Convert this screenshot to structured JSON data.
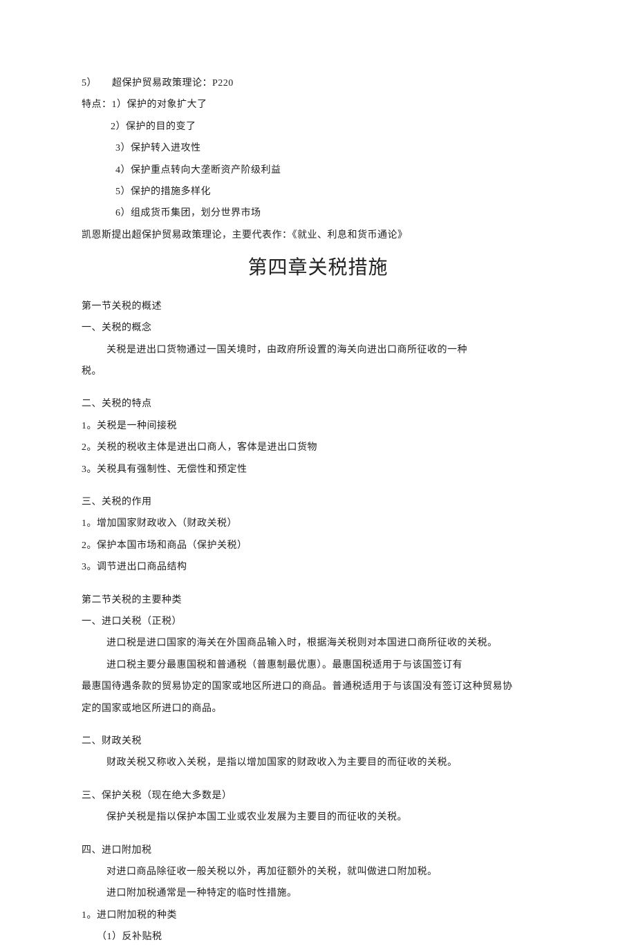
{
  "top": {
    "theory": "5）　　超保护贸易政策理论：P220",
    "featuresLabel": "特点：1）保护的对象扩大了",
    "feat2": "2）保护的目的变了",
    "feat3": "3）保护转入进攻性",
    "feat4": "4）保护重点转向大垄断资产阶级利益",
    "feat5": "5）保护的措施多样化",
    "feat6": "6）组成货币集团，划分世界市场",
    "keynes": "凯恩斯提出超保护贸易政策理论，主要代表作：《就业、利息和货币通论》"
  },
  "chapterTitle": "第四章关税措施",
  "sec1": {
    "title": "第一节关税的概述",
    "s1h": "一、关税的概念",
    "s1p1": "关税是进出口货物通过一国关境时，由政府所设置的海关向进出口商所征收的一种",
    "s1p2": "税。",
    "s2h": "二、关税的特点",
    "s2i1": "1。关税是一种间接税",
    "s2i2": "2。关税的税收主体是进出口商人，客体是进出口货物",
    "s2i3": "3。关税具有强制性、无偿性和预定性",
    "s3h": "三、关税的作用",
    "s3i1": "1。增加国家财政收入（财政关税）",
    "s3i2": "2。保护本国市场和商品（保护关税）",
    "s3i3": "3。调节进出口商品结构"
  },
  "sec2": {
    "title": "第二节关税的主要种类",
    "s1h": "一、进口关税（正税）",
    "s1p1": "进口税是进口国家的海关在外国商品输入时，根据海关税则对本国进口商所征收的关税。",
    "s1p2": "进口税主要分最惠国税和普通税（普惠制最优惠）。最惠国税适用于与该国签订有",
    "s1p3": "最惠国待遇条款的贸易协定的国家或地区所进口的商品。普通税适用于与该国没有签订这种贸易协",
    "s1p4": "定的国家或地区所进口的商品。",
    "s2h": "二、财政关税",
    "s2p1": "财政关税又称收入关税，是指以增加国家的财政收入为主要目的而征收的关税。",
    "s3h": "三、保护关税（现在绝大多数是）",
    "s3p1": "保护关税是指以保护本国工业或农业发展为主要目的而征收的关税。",
    "s4h": "四、进口附加税",
    "s4p1": "对进口商品除征收一般关税以外，再加征额外的关税，就叫做进口附加税。",
    "s4p2": "进口附加税通常是一种特定的临时性措施。",
    "s4i1": "1。进口附加税的种类",
    "s4i1a": "（1）反补贴税"
  }
}
